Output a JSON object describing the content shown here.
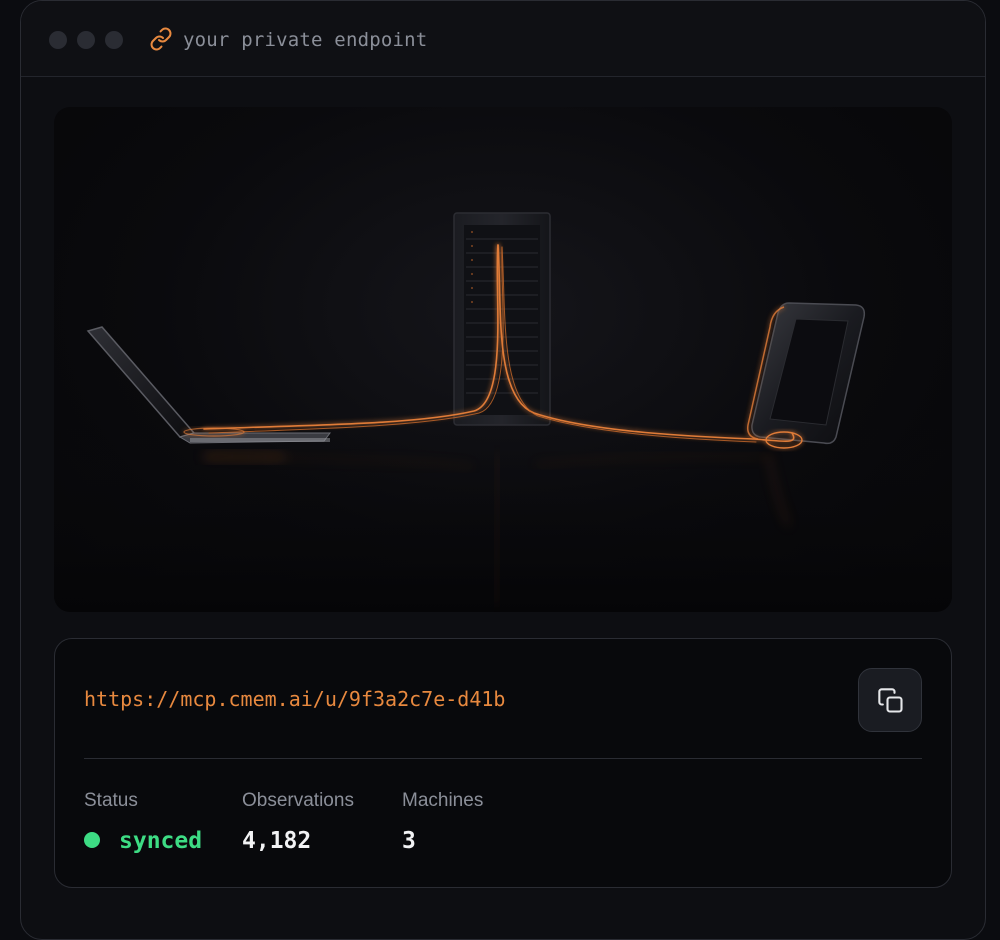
{
  "window": {
    "title": "your private endpoint",
    "title_icon": "link-icon"
  },
  "illustration": {
    "description_icons": [
      "laptop",
      "server-rack",
      "smartphone",
      "cable"
    ]
  },
  "endpoint": {
    "url": "https://mcp.cmem.ai/u/9f3a2c7e-d41b",
    "copy_icon": "copy-icon"
  },
  "stats": {
    "status": {
      "label": "Status",
      "value": "synced"
    },
    "observations": {
      "label": "Observations",
      "value": "4,182"
    },
    "machines": {
      "label": "Machines",
      "value": "3"
    }
  },
  "colors": {
    "accent": "#e8893f",
    "status_ok": "#3ddc84",
    "background": "#0d0e12"
  }
}
